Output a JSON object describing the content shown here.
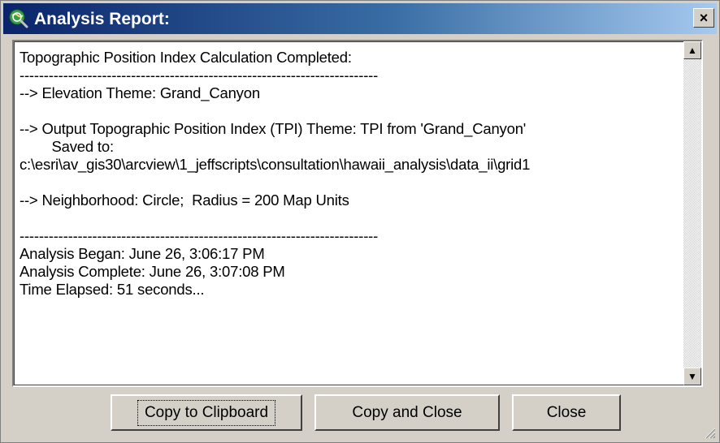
{
  "window": {
    "title": "Analysis Report:",
    "close_glyph": "×"
  },
  "report": {
    "text": "Topographic Position Index Calculation Completed:\n--------------------------------------------------------------------------\n--> Elevation Theme: Grand_Canyon\n\n--> Output Topographic Position Index (TPI) Theme: TPI from 'Grand_Canyon'\n        Saved to:\nc:\\esri\\av_gis30\\arcview\\1_jeffscripts\\consultation\\hawaii_analysis\\data_ii\\grid1\n\n--> Neighborhood: Circle;  Radius = 200 Map Units\n\n--------------------------------------------------------------------------\nAnalysis Began: June 26, 3:06:17 PM\nAnalysis Complete: June 26, 3:07:08 PM\nTime Elapsed: 51 seconds..."
  },
  "scrollbar": {
    "up_glyph": "▲",
    "down_glyph": "▼"
  },
  "buttons": {
    "copy_clipboard": "Copy to Clipboard",
    "copy_and_close": "Copy and Close",
    "close": "Close"
  },
  "icons": {
    "app": "globe-magnifier-icon",
    "close": "close-icon",
    "up": "scroll-up-arrow-icon",
    "down": "scroll-down-arrow-icon",
    "grip": "resize-grip-icon"
  }
}
